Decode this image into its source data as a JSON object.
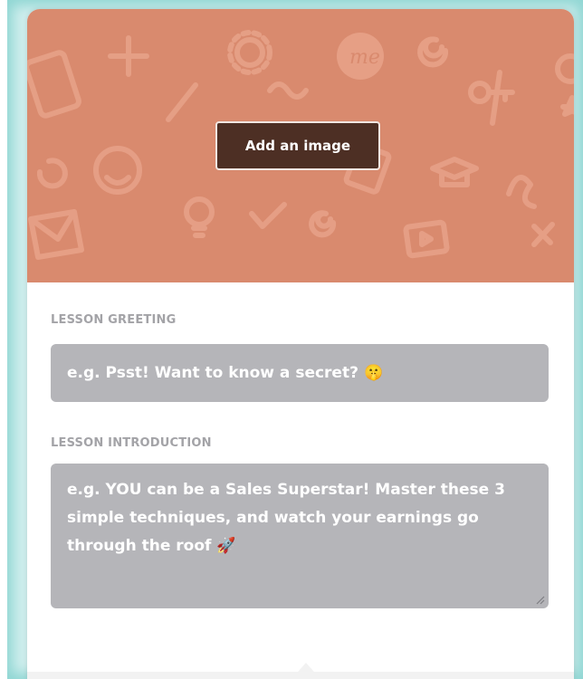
{
  "hero": {
    "add_image_label": "Add an image",
    "background_color": "#d98a6e",
    "button_color": "#4d2f24"
  },
  "greeting": {
    "label": "LESSON GREETING",
    "placeholder": "e.g. Psst! Want to know a secret?",
    "emoji": "🤫"
  },
  "introduction": {
    "label": "LESSON INTRODUCTION",
    "placeholder": "e.g. YOU can be a Sales Superstar! Master these 3 simple techniques, and watch your earnings go through the roof",
    "emoji": "🚀"
  },
  "colors": {
    "field_background": "#b5b5b9",
    "label_text": "#a3a3a7",
    "frame_glow": "#8fd6d3"
  }
}
